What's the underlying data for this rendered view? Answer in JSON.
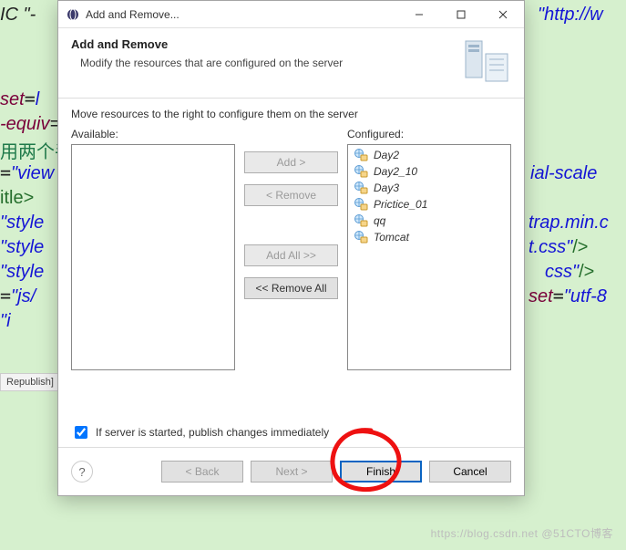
{
  "window": {
    "title": "Add and Remove...",
    "minimize_name": "minimize-icon",
    "maximize_name": "maximize-icon",
    "close_name": "close-icon"
  },
  "header": {
    "title": "Add and Remove",
    "desc": "Modify the resources that are configured on the server"
  },
  "body": {
    "instruction": "Move resources to the right to configure them on the server",
    "available_label": "Available:",
    "configured_label": "Configured:",
    "buttons": {
      "add": "Add >",
      "remove": "< Remove",
      "add_all": "Add All >>",
      "remove_all": "<< Remove All"
    },
    "configured_items": [
      {
        "name": "Day2"
      },
      {
        "name": "Day2_10"
      },
      {
        "name": "Day3"
      },
      {
        "name": "Prictice_01"
      },
      {
        "name": "qq"
      },
      {
        "name": "Tomcat"
      }
    ],
    "checkbox_label": "If server is started, publish changes immediately",
    "checkbox_checked": true
  },
  "footer": {
    "back": "< Back",
    "next": "Next >",
    "finish": "Finish",
    "cancel": "Cancel",
    "help_tooltip": "Help"
  },
  "background_code": {
    "l1a": "IC \"-",
    "l1b": "\"http://w",
    "l3": "set=\"",
    "l3b": "l",
    "l4": "-equiv",
    "l4b": "=",
    "l5": "用两个手",
    "l6": "=\"",
    "l6b": "view",
    "l6c": "ial-scale",
    "l7": "itle>",
    "l8": "\"style",
    "l8b": "trap.min.c",
    "l9": "\"style",
    "l9b": "t.css\"",
    "l9c": "/>",
    "l10": "\"style",
    "l10b": "css\"",
    "l10c": "/>",
    "l11": "=",
    "l11b": "\"js/",
    "l11c": "set=",
    "l11d": "\"utf-8",
    "l12": "\"i"
  },
  "status": {
    "republish": "Republish]"
  },
  "watermark": "https://blog.csdn.net @51CTO博客"
}
